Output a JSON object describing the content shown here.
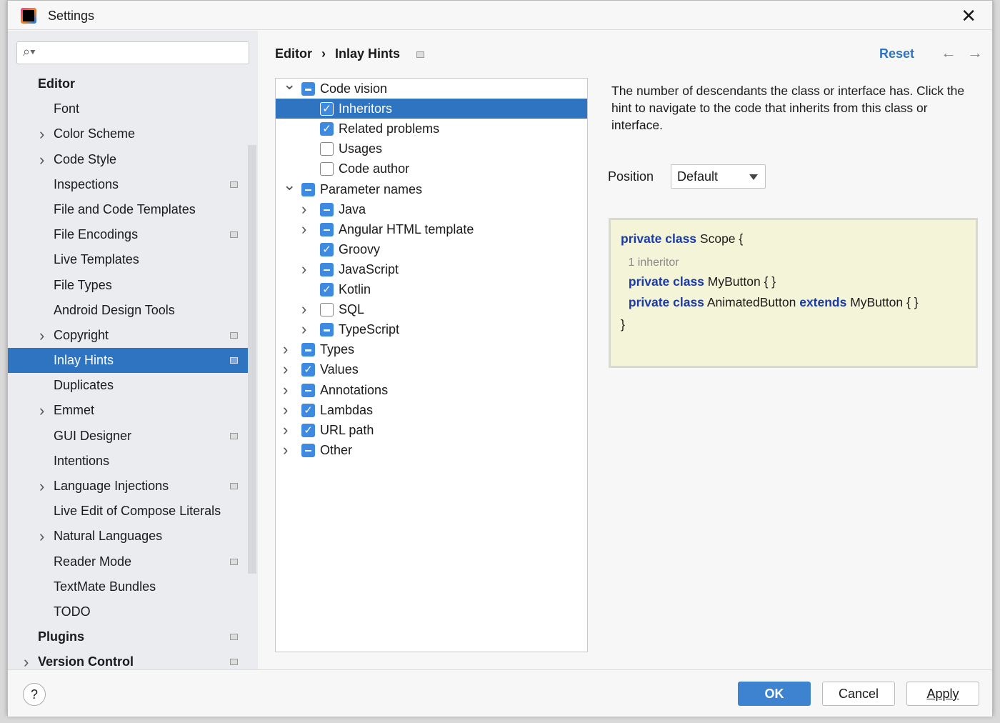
{
  "window": {
    "title": "Settings",
    "close_icon": "close-icon"
  },
  "search": {
    "placeholder": "",
    "value": ""
  },
  "sidebar": {
    "items": [
      {
        "label": "Editor",
        "level": 0,
        "bold": true,
        "chevron": false,
        "badge": false
      },
      {
        "label": "Font",
        "level": 1,
        "chevron": false,
        "badge": false
      },
      {
        "label": "Color Scheme",
        "level": 1,
        "chevron": true,
        "badge": false
      },
      {
        "label": "Code Style",
        "level": 1,
        "chevron": true,
        "badge": false
      },
      {
        "label": "Inspections",
        "level": 1,
        "chevron": false,
        "badge": true
      },
      {
        "label": "File and Code Templates",
        "level": 1,
        "chevron": false,
        "badge": false
      },
      {
        "label": "File Encodings",
        "level": 1,
        "chevron": false,
        "badge": true
      },
      {
        "label": "Live Templates",
        "level": 1,
        "chevron": false,
        "badge": false
      },
      {
        "label": "File Types",
        "level": 1,
        "chevron": false,
        "badge": false
      },
      {
        "label": "Android Design Tools",
        "level": 1,
        "chevron": false,
        "badge": false
      },
      {
        "label": "Copyright",
        "level": 1,
        "chevron": true,
        "badge": true
      },
      {
        "label": "Inlay Hints",
        "level": 1,
        "chevron": false,
        "badge": true,
        "selected": true
      },
      {
        "label": "Duplicates",
        "level": 1,
        "chevron": false,
        "badge": false
      },
      {
        "label": "Emmet",
        "level": 1,
        "chevron": true,
        "badge": false
      },
      {
        "label": "GUI Designer",
        "level": 1,
        "chevron": false,
        "badge": true
      },
      {
        "label": "Intentions",
        "level": 1,
        "chevron": false,
        "badge": false
      },
      {
        "label": "Language Injections",
        "level": 1,
        "chevron": true,
        "badge": true
      },
      {
        "label": "Live Edit of Compose Literals",
        "level": 1,
        "chevron": false,
        "badge": false
      },
      {
        "label": "Natural Languages",
        "level": 1,
        "chevron": true,
        "badge": false
      },
      {
        "label": "Reader Mode",
        "level": 1,
        "chevron": false,
        "badge": true
      },
      {
        "label": "TextMate Bundles",
        "level": 1,
        "chevron": false,
        "badge": false
      },
      {
        "label": "TODO",
        "level": 1,
        "chevron": false,
        "badge": false
      },
      {
        "label": "Plugins",
        "level": 0,
        "bold": true,
        "chevron": false,
        "badge": true
      },
      {
        "label": "Version Control",
        "level": 0,
        "bold": true,
        "chevron": true,
        "badge": true
      }
    ]
  },
  "breadcrumb": {
    "items": [
      "Editor",
      "Inlay Hints"
    ],
    "separator": "›"
  },
  "header": {
    "reset_label": "Reset"
  },
  "tree": [
    {
      "label": "Code vision",
      "level": 0,
      "chevron": "down",
      "state": "partial"
    },
    {
      "label": "Inheritors",
      "level": 1,
      "chevron": "",
      "state": "checked",
      "selected": true
    },
    {
      "label": "Related problems",
      "level": 1,
      "chevron": "",
      "state": "checked"
    },
    {
      "label": "Usages",
      "level": 1,
      "chevron": "",
      "state": "unchecked"
    },
    {
      "label": "Code author",
      "level": 1,
      "chevron": "",
      "state": "unchecked"
    },
    {
      "label": "Parameter names",
      "level": 0,
      "chevron": "down",
      "state": "partial"
    },
    {
      "label": "Java",
      "level": 1,
      "chevron": "right",
      "state": "partial"
    },
    {
      "label": "Angular HTML template",
      "level": 1,
      "chevron": "right",
      "state": "partial"
    },
    {
      "label": "Groovy",
      "level": 1,
      "chevron": "",
      "state": "checked"
    },
    {
      "label": "JavaScript",
      "level": 1,
      "chevron": "right",
      "state": "partial"
    },
    {
      "label": "Kotlin",
      "level": 1,
      "chevron": "",
      "state": "checked"
    },
    {
      "label": "SQL",
      "level": 1,
      "chevron": "right",
      "state": "unchecked"
    },
    {
      "label": "TypeScript",
      "level": 1,
      "chevron": "right",
      "state": "partial"
    },
    {
      "label": "Types",
      "level": 0,
      "chevron": "right",
      "state": "partial"
    },
    {
      "label": "Values",
      "level": 0,
      "chevron": "right",
      "state": "checked"
    },
    {
      "label": "Annotations",
      "level": 0,
      "chevron": "right",
      "state": "partial"
    },
    {
      "label": "Lambdas",
      "level": 0,
      "chevron": "right",
      "state": "checked"
    },
    {
      "label": "URL path",
      "level": 0,
      "chevron": "right",
      "state": "checked"
    },
    {
      "label": "Other",
      "level": 0,
      "chevron": "right",
      "state": "partial"
    }
  ],
  "details": {
    "description": "The number of descendants the class or interface has. Click the hint to navigate to the code that inherits from this class or interface.",
    "position_label": "Position",
    "position_value": "Default"
  },
  "preview": {
    "lines": [
      [
        {
          "t": "private class",
          "k": true
        },
        {
          "t": " Scope {"
        }
      ],
      [
        {
          "t": " 1 inheritor",
          "h": true
        }
      ],
      [
        {
          "t": " "
        },
        {
          "t": "private class",
          "k": true
        },
        {
          "t": " MyButton { }"
        }
      ],
      [
        {
          "t": " "
        },
        {
          "t": "private class",
          "k": true
        },
        {
          "t": " AnimatedButton "
        },
        {
          "t": "extends",
          "k": true
        },
        {
          "t": " MyButton { }"
        }
      ],
      [
        {
          "t": "}"
        }
      ]
    ]
  },
  "footer": {
    "help": "?",
    "ok": "OK",
    "cancel": "Cancel",
    "apply": "Apply"
  },
  "colors": {
    "accent": "#2f74c0",
    "checkbox": "#3d8ae0",
    "keyword": "#1a3aa8",
    "preview_bg": "#f4f4d8"
  }
}
